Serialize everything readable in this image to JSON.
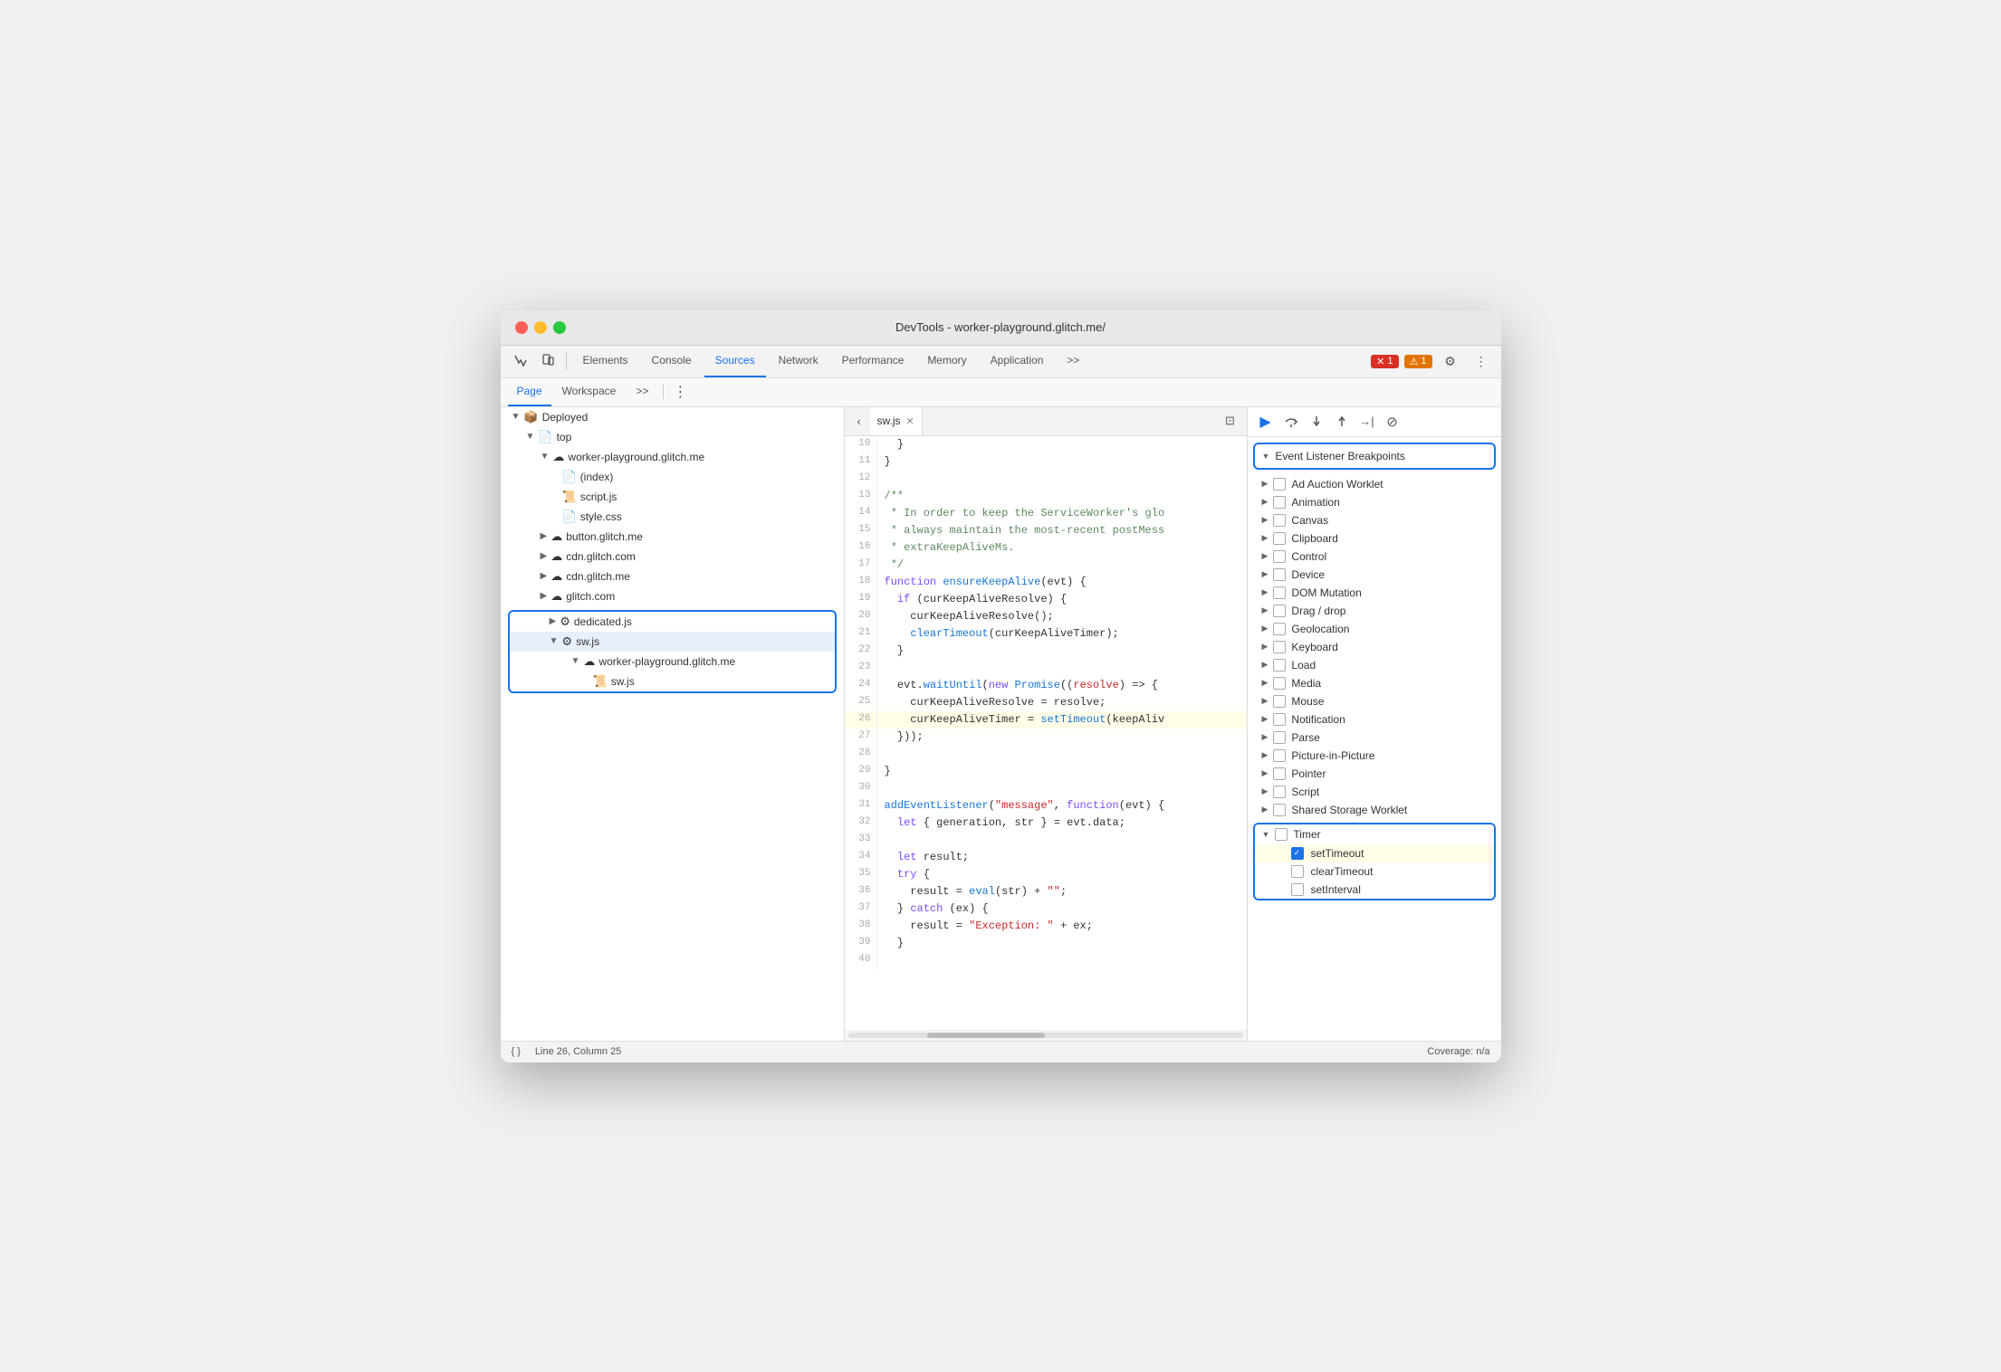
{
  "window": {
    "title": "DevTools - worker-playground.glitch.me/"
  },
  "toolbar": {
    "tabs": [
      {
        "label": "Elements",
        "active": false
      },
      {
        "label": "Console",
        "active": false
      },
      {
        "label": "Sources",
        "active": true
      },
      {
        "label": "Network",
        "active": false
      },
      {
        "label": "Performance",
        "active": false
      },
      {
        "label": "Memory",
        "active": false
      },
      {
        "label": "Application",
        "active": false
      }
    ],
    "error_count": "1",
    "warning_count": "1",
    "more_tabs": ">>"
  },
  "sub_toolbar": {
    "tabs": [
      {
        "label": "Page",
        "active": true
      },
      {
        "label": "Workspace",
        "active": false
      }
    ]
  },
  "file_tree": {
    "items": [
      {
        "indent": 0,
        "arrow": "▼",
        "icon": "📦",
        "label": "Deployed"
      },
      {
        "indent": 1,
        "arrow": "▼",
        "icon": "📄",
        "label": "top"
      },
      {
        "indent": 2,
        "arrow": "▼",
        "icon": "☁️",
        "label": "worker-playground.glitch.me"
      },
      {
        "indent": 3,
        "arrow": "",
        "icon": "📄",
        "label": "(index)"
      },
      {
        "indent": 3,
        "arrow": "",
        "icon": "📜",
        "label": "script.js",
        "color": "orange"
      },
      {
        "indent": 3,
        "arrow": "",
        "icon": "💜",
        "label": "style.css",
        "color": "purple"
      },
      {
        "indent": 2,
        "arrow": "▶",
        "icon": "☁️",
        "label": "button.glitch.me"
      },
      {
        "indent": 2,
        "arrow": "▶",
        "icon": "☁️",
        "label": "cdn.glitch.com"
      },
      {
        "indent": 2,
        "arrow": "▶",
        "icon": "☁️",
        "label": "cdn.glitch.me"
      },
      {
        "indent": 2,
        "arrow": "▶",
        "icon": "☁️",
        "label": "glitch.com"
      }
    ],
    "selected_group": {
      "items": [
        {
          "indent": 2,
          "arrow": "▶",
          "icon": "⚙️",
          "label": "dedicated.js"
        },
        {
          "indent": 2,
          "arrow": "▼",
          "icon": "⚙️",
          "label": "sw.js",
          "selected": true
        },
        {
          "indent": 3,
          "arrow": "▼",
          "icon": "☁️",
          "label": "worker-playground.glitch.me"
        },
        {
          "indent": 4,
          "arrow": "",
          "icon": "📜",
          "label": "sw.js",
          "color": "orange"
        }
      ]
    }
  },
  "editor": {
    "open_file": "sw.js",
    "lines": [
      {
        "num": 10,
        "content": "  }"
      },
      {
        "num": 11,
        "content": "}"
      },
      {
        "num": 12,
        "content": ""
      },
      {
        "num": 13,
        "content": "/**",
        "type": "comment"
      },
      {
        "num": 14,
        "content": " * In order to keep the ServiceWorker's glo",
        "type": "comment"
      },
      {
        "num": 15,
        "content": " * always maintain the most-recent postMess",
        "type": "comment"
      },
      {
        "num": 16,
        "content": " * extraKeepAliveMs.",
        "type": "comment"
      },
      {
        "num": 17,
        "content": " */",
        "type": "comment"
      },
      {
        "num": 18,
        "content": "function ensureKeepAlive(evt) {"
      },
      {
        "num": 19,
        "content": "  if (curKeepAliveResolve) {"
      },
      {
        "num": 20,
        "content": "    curKeepAliveResolve();"
      },
      {
        "num": 21,
        "content": "    clearTimeout(curKeepAliveTimer);"
      },
      {
        "num": 22,
        "content": "  }"
      },
      {
        "num": 23,
        "content": ""
      },
      {
        "num": 24,
        "content": "  evt.waitUntil(new Promise((resolve) => {"
      },
      {
        "num": 25,
        "content": "    curKeepAliveResolve = resolve;"
      },
      {
        "num": 26,
        "content": "    curKeepAliveTimer = setTimeout(keepAliv",
        "highlighted": true
      },
      {
        "num": 27,
        "content": "  }));"
      },
      {
        "num": 28,
        "content": ""
      },
      {
        "num": 29,
        "content": "}"
      },
      {
        "num": 30,
        "content": ""
      },
      {
        "num": 31,
        "content": "addEventListener(\"message\", function(evt) {"
      },
      {
        "num": 32,
        "content": "  let { generation, str } = evt.data;"
      },
      {
        "num": 33,
        "content": ""
      },
      {
        "num": 34,
        "content": "  let result;"
      },
      {
        "num": 35,
        "content": "  try {"
      },
      {
        "num": 36,
        "content": "    result = eval(str) + \"\";"
      },
      {
        "num": 37,
        "content": "  } catch (ex) {"
      },
      {
        "num": 38,
        "content": "    result = \"Exception: \" + ex;"
      },
      {
        "num": 39,
        "content": "  }"
      },
      {
        "num": 40,
        "content": ""
      }
    ]
  },
  "breakpoints": {
    "section_title": "Event Listener Breakpoints",
    "categories": [
      {
        "label": "Ad Auction Worklet",
        "arrow": "▶",
        "checked": false
      },
      {
        "label": "Animation",
        "arrow": "▶",
        "checked": false
      },
      {
        "label": "Canvas",
        "arrow": "▶",
        "checked": false
      },
      {
        "label": "Clipboard",
        "arrow": "▶",
        "checked": false
      },
      {
        "label": "Control",
        "arrow": "▶",
        "checked": false
      },
      {
        "label": "Device",
        "arrow": "▶",
        "checked": false
      },
      {
        "label": "DOM Mutation",
        "arrow": "▶",
        "checked": false
      },
      {
        "label": "Drag / drop",
        "arrow": "▶",
        "checked": false
      },
      {
        "label": "Geolocation",
        "arrow": "▶",
        "checked": false
      },
      {
        "label": "Keyboard",
        "arrow": "▶",
        "checked": false
      },
      {
        "label": "Load",
        "arrow": "▶",
        "checked": false
      },
      {
        "label": "Media",
        "arrow": "▶",
        "checked": false
      },
      {
        "label": "Mouse",
        "arrow": "▶",
        "checked": false
      },
      {
        "label": "Notification",
        "arrow": "▶",
        "checked": false
      },
      {
        "label": "Parse",
        "arrow": "▶",
        "checked": false
      },
      {
        "label": "Picture-in-Picture",
        "arrow": "▶",
        "checked": false
      },
      {
        "label": "Pointer",
        "arrow": "▶",
        "checked": false
      },
      {
        "label": "Script",
        "arrow": "▶",
        "checked": false
      },
      {
        "label": "Shared Storage Worklet",
        "arrow": "▶",
        "checked": false
      }
    ],
    "timer": {
      "label": "Timer",
      "arrow": "▼",
      "children": [
        {
          "label": "setTimeout",
          "checked": true,
          "highlighted": true
        },
        {
          "label": "clearTimeout",
          "checked": false
        },
        {
          "label": "setInterval",
          "checked": false
        }
      ]
    }
  },
  "status_bar": {
    "format_btn": "{ }",
    "position": "Line 26, Column 25",
    "coverage": "Coverage: n/a"
  },
  "debugger": {
    "buttons": [
      "▶",
      "↺",
      "↓",
      "↑",
      "→|",
      "⊘"
    ]
  }
}
